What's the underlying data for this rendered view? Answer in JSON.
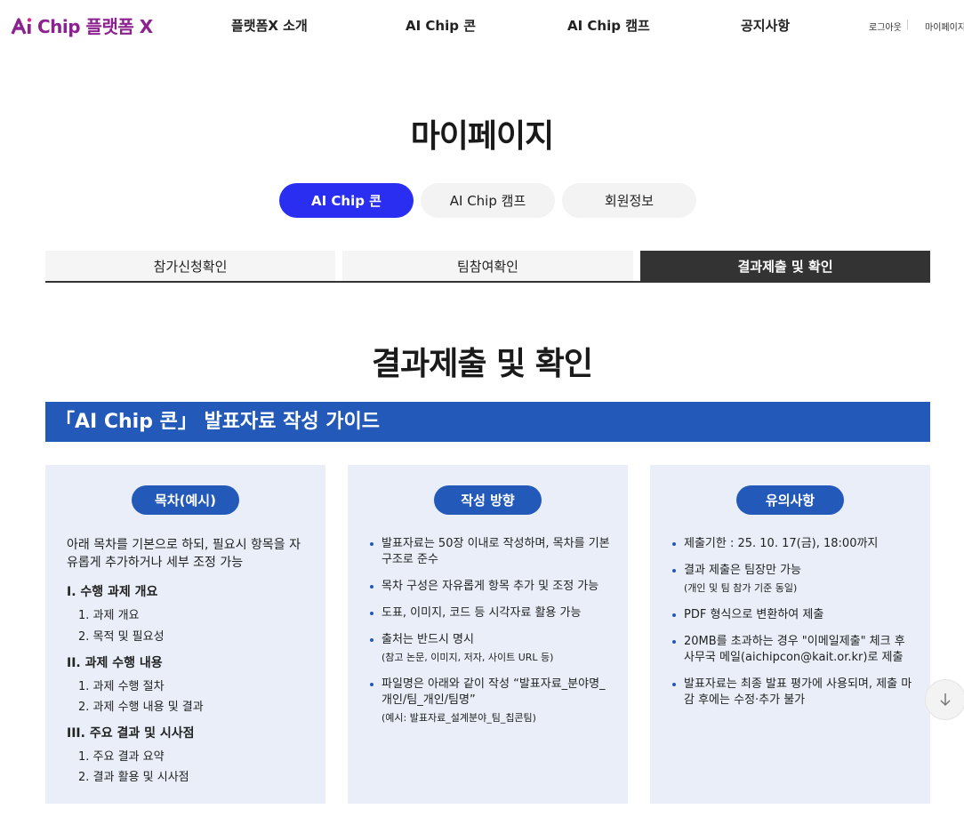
{
  "header": {
    "logo_text": "Chip 플랫폼 X",
    "nav": [
      "플랫폼X 소개",
      "AI Chip 콘",
      "AI Chip 캠프",
      "공지사항"
    ],
    "logout": "로그아웃",
    "mypage": "마이페이지",
    "brand_color": "#8e2190"
  },
  "page_title": "마이페이지",
  "pill_tabs": [
    {
      "label": "AI Chip 콘",
      "active": true
    },
    {
      "label": "AI Chip 캠프",
      "active": false
    },
    {
      "label": "회원정보",
      "active": false
    }
  ],
  "sub_tabs": [
    {
      "label": "참가신청확인",
      "active": false
    },
    {
      "label": "팀참여확인",
      "active": false
    },
    {
      "label": "결과제출 및 확인",
      "active": true
    }
  ],
  "section_title": "결과제출 및 확인",
  "guide_title": "「AI Chip 콘」 발표자료 작성 가이드",
  "cards": [
    {
      "badge": "목차(예시)",
      "intro": "아래 목차를 기본으로 하되, 필요시 항목을 자유롭게 추가하거나 세부 조정 가능",
      "sections": [
        {
          "heading": "I. 수행 과제 개요",
          "items": [
            "1. 과제 개요",
            "2. 목적 및 필요성"
          ]
        },
        {
          "heading": "II. 과제 수행 내용",
          "items": [
            "1. 과제 수행 절차",
            "2. 과제 수행 내용 및 결과"
          ]
        },
        {
          "heading": "III. 주요 결과 및 시사점",
          "items": [
            "1. 주요 결과 요약",
            "2. 결과 활용 및 시사점"
          ]
        }
      ]
    },
    {
      "badge": "작성 방향",
      "bullets": [
        {
          "text": "발표자료는 50장 이내로 작성하며, 목차를 기본 구조로 준수",
          "sub": ""
        },
        {
          "text": "목차 구성은 자유롭게 항목 추가 및 조정 가능",
          "sub": ""
        },
        {
          "text": "도표, 이미지, 코드 등 시각자료 활용 가능",
          "sub": ""
        },
        {
          "text": "출처는 반드시 명시",
          "sub": "(참고 논문, 이미지, 저자, 사이트 URL 등)"
        },
        {
          "text": "파일명은 아래와 같이 작성 “발표자료_분야명_개인/팀_개인/팀명”",
          "sub": "(예시: 발표자료_설계분야_팀_칩콘팀)"
        }
      ]
    },
    {
      "badge": "유의사항",
      "bullets": [
        {
          "text": "제출기한 : 25. 10. 17(금), 18:00까지",
          "sub": ""
        },
        {
          "text": "결과 제출은 팀장만 가능",
          "sub": "(개인 및 팀 참가 기준 동일)"
        },
        {
          "text": "PDF 형식으로 변환하여 제출",
          "sub": ""
        },
        {
          "text": "20MB를 초과하는 경우 \"이메일제출\" 체크 후 사무국 메일(aichipcon@kait.or.kr)로 제출",
          "sub": ""
        },
        {
          "text": "발표자료는 최종 발표 평가에 사용되며, 제출 마감 후에는 수정·추가 불가",
          "sub": ""
        }
      ]
    }
  ],
  "scroll_icon": "arrow-down-icon"
}
